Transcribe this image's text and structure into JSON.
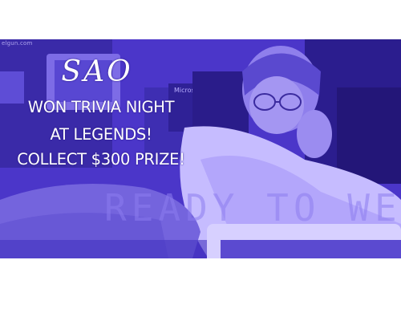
{
  "photo": {
    "watermark": "elgun.com",
    "box_label": "Microsoft",
    "screen_text": "READY TO WE",
    "tint_color": "#4a34c8"
  },
  "overlay": {
    "title": "SAO",
    "lines": [
      "WON TRIVIA NIGHT",
      "AT LEGENDS!",
      "COLLECT $300 PRIZE!"
    ],
    "text_color": "#ffffff"
  }
}
